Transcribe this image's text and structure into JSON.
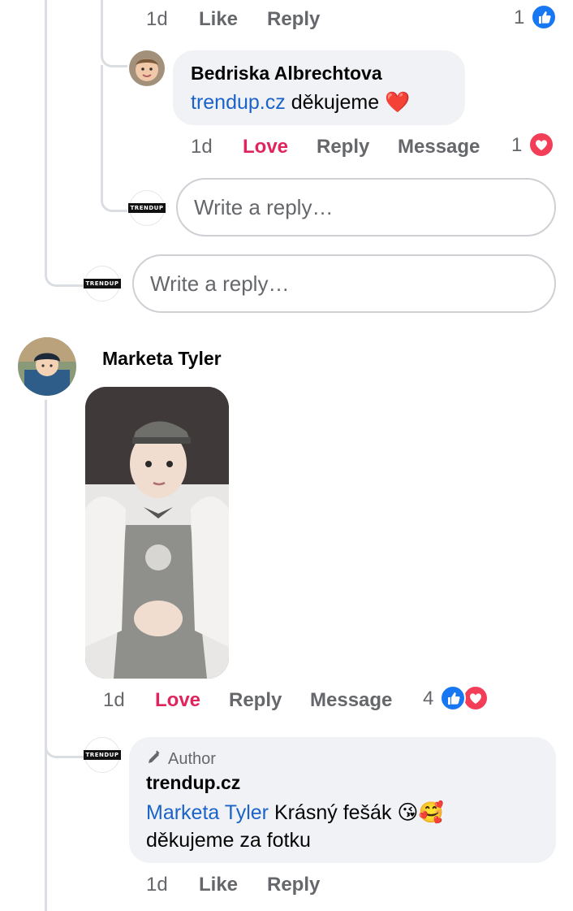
{
  "top_comment": {
    "time": "1d",
    "like": "Like",
    "reply": "Reply",
    "reaction_count": "1"
  },
  "reply_bedriska": {
    "author": "Bedriska Albrechtova",
    "mention": "trendup.cz",
    "text": "děkujeme",
    "emoji": "❤️",
    "time": "1d",
    "love": "Love",
    "reply": "Reply",
    "message": "Message",
    "reaction_count": "1"
  },
  "reply_inputs": {
    "inner_placeholder": "Write a reply…",
    "outer_placeholder": "Write a reply…"
  },
  "brand": {
    "logo_text": "TRENDUP"
  },
  "comment_marketa": {
    "author": "Marketa Tyler",
    "time": "1d",
    "love": "Love",
    "reply": "Reply",
    "message": "Message",
    "reaction_count": "4"
  },
  "reply_trendup": {
    "badge": "Author",
    "author": "trendup.cz",
    "mention": "Marketa Tyler",
    "text_line1": "Krásný fešák 😘🥰",
    "text_line2": "děkujeme za fotku",
    "time": "1d",
    "like": "Like",
    "reply": "Reply"
  },
  "colors": {
    "accent_blue": "#1877f2",
    "love_red": "#e0245e",
    "mention_blue": "#1b63c9",
    "muted_gray": "#65676b",
    "bubble_bg": "#f0f2f5"
  }
}
